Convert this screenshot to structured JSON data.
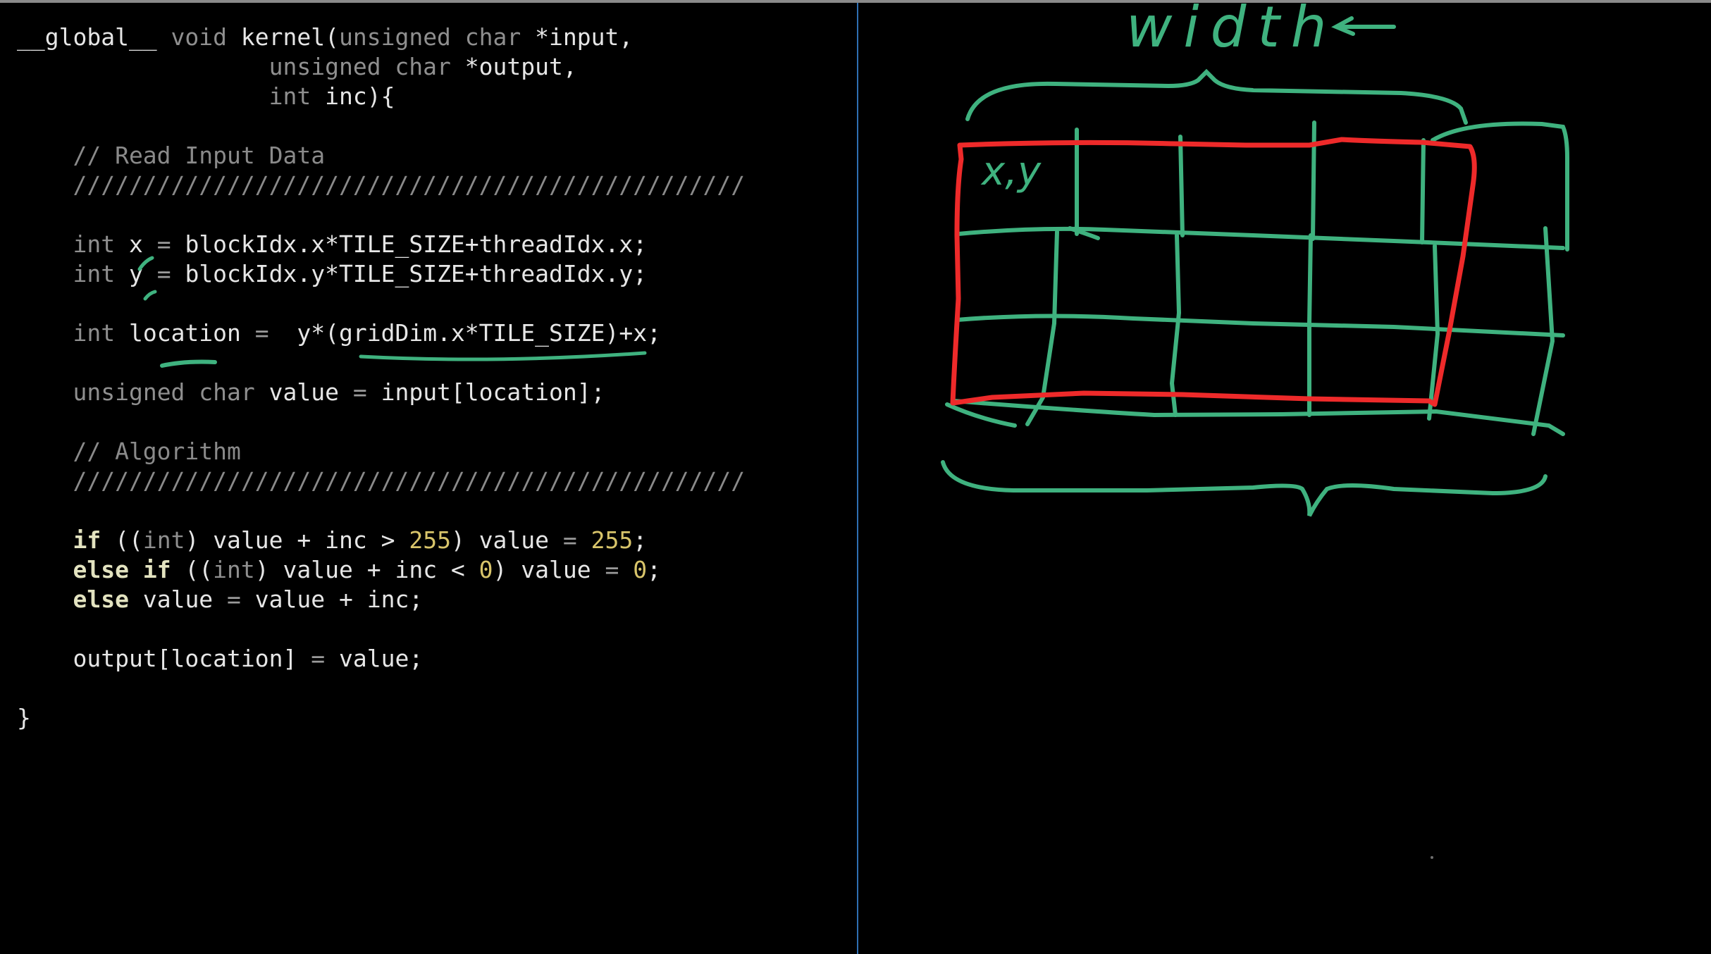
{
  "code": {
    "lines": [
      [
        [
          "plain",
          "__global__ "
        ],
        [
          "type",
          "void"
        ],
        [
          "plain",
          " kernel("
        ],
        [
          "type",
          "unsigned char"
        ],
        [
          "plain",
          " *input,"
        ]
      ],
      [
        [
          "plain",
          "                  "
        ],
        [
          "type",
          "unsigned char"
        ],
        [
          "plain",
          " *output,"
        ]
      ],
      [
        [
          "plain",
          "                  "
        ],
        [
          "type",
          "int"
        ],
        [
          "plain",
          " inc){"
        ]
      ],
      [],
      [
        [
          "comment",
          "    // Read Input Data"
        ]
      ],
      [
        [
          "comment",
          "    ////////////////////////////////////////////////"
        ]
      ],
      [],
      [
        [
          "plain",
          "    "
        ],
        [
          "type",
          "int"
        ],
        [
          "plain",
          " x "
        ],
        [
          "op",
          "="
        ],
        [
          "plain",
          " blockIdx.x*TILE_SIZE+threadIdx.x;"
        ]
      ],
      [
        [
          "plain",
          "    "
        ],
        [
          "type",
          "int"
        ],
        [
          "plain",
          " y "
        ],
        [
          "op",
          "="
        ],
        [
          "plain",
          " blockIdx.y*TILE_SIZE+threadIdx.y;"
        ]
      ],
      [],
      [
        [
          "plain",
          "    "
        ],
        [
          "type",
          "int"
        ],
        [
          "plain",
          " location "
        ],
        [
          "op",
          "="
        ],
        [
          "plain",
          "  y*(gridDim.x*TILE_SIZE)+x;"
        ]
      ],
      [],
      [
        [
          "plain",
          "    "
        ],
        [
          "type",
          "unsigned char"
        ],
        [
          "plain",
          " value "
        ],
        [
          "op",
          "="
        ],
        [
          "plain",
          " input[location];"
        ]
      ],
      [],
      [
        [
          "comment",
          "    // Algorithm"
        ]
      ],
      [
        [
          "comment",
          "    ////////////////////////////////////////////////"
        ]
      ],
      [],
      [
        [
          "plain",
          "    "
        ],
        [
          "kw",
          "if"
        ],
        [
          "plain",
          " (("
        ],
        [
          "type",
          "int"
        ],
        [
          "plain",
          ") value + inc > "
        ],
        [
          "num",
          "255"
        ],
        [
          "plain",
          ") value "
        ],
        [
          "op",
          "="
        ],
        [
          "plain",
          " "
        ],
        [
          "num",
          "255"
        ],
        [
          "plain",
          ";"
        ]
      ],
      [
        [
          "plain",
          "    "
        ],
        [
          "kw",
          "else if"
        ],
        [
          "plain",
          " (("
        ],
        [
          "type",
          "int"
        ],
        [
          "plain",
          ") value + inc < "
        ],
        [
          "num",
          "0"
        ],
        [
          "plain",
          ") value "
        ],
        [
          "op",
          "="
        ],
        [
          "plain",
          " "
        ],
        [
          "num",
          "0"
        ],
        [
          "plain",
          ";"
        ]
      ],
      [
        [
          "plain",
          "    "
        ],
        [
          "kw",
          "else"
        ],
        [
          "plain",
          " value "
        ],
        [
          "op",
          "="
        ],
        [
          "plain",
          " value + inc;"
        ]
      ],
      [],
      [
        [
          "plain",
          "    output[location] "
        ],
        [
          "op",
          "="
        ],
        [
          "plain",
          " value;"
        ]
      ],
      [],
      [
        [
          "plain",
          "}"
        ]
      ]
    ]
  },
  "drawing": {
    "width_label": "width",
    "cell_label": "x,y"
  },
  "colors": {
    "ink_green": "#3fb27f",
    "ink_red": "#ee2a2a",
    "divider": "#2f6fb3",
    "background": "#000000"
  }
}
